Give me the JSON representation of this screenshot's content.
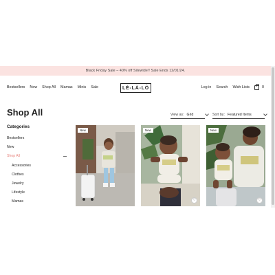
{
  "promo": {
    "text": "Black Friday Sale – 40% off Sitewide!! Sale Ends 12/01/24."
  },
  "header": {
    "nav_left": [
      "Bestsellers",
      "New",
      "Shop All",
      "Mamas",
      "Minis",
      "Sale"
    ],
    "logo": "LÈ-LÀ-LÔ",
    "login": "Log in",
    "search": "Search",
    "wishlist": "Wish Lists",
    "cart_count": "0"
  },
  "page": {
    "title": "Shop All"
  },
  "toolbar": {
    "view_label": "View as",
    "view_value": "Grid",
    "sort_label": "Sort by",
    "sort_value": "Featured Items"
  },
  "sidebar": {
    "title": "Categories",
    "items": [
      "Bestsellers",
      "New",
      "Shop All"
    ],
    "subitems": [
      "Accessories",
      "Clothes",
      "Jewelry",
      "Lifestyle",
      "Mamas"
    ]
  },
  "products": [
    {
      "badge": "New"
    },
    {
      "badge": "New"
    },
    {
      "badge": "New"
    }
  ],
  "colors": {
    "promo_bg": "#fbe3e1",
    "accent": "#e8857f",
    "text": "#222222"
  }
}
